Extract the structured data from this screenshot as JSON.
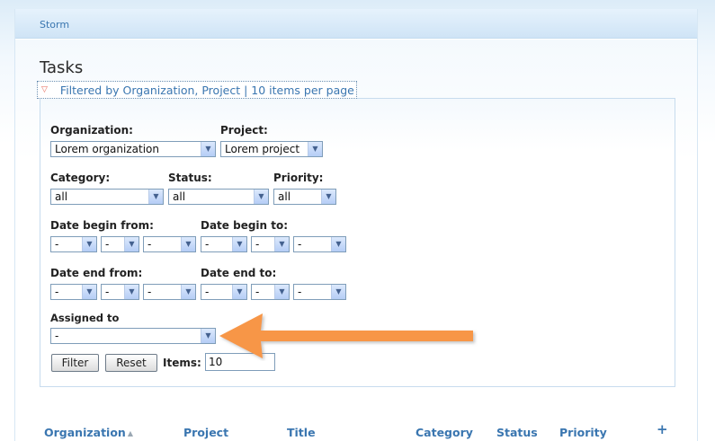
{
  "header": {
    "site_name": "Storm"
  },
  "page_title": "Tasks",
  "filter": {
    "legend": "Filtered by Organization, Project | 10 items per page",
    "organization": {
      "label": "Organization:",
      "value": "Lorem organization"
    },
    "project": {
      "label": "Project:",
      "value": "Lorem project"
    },
    "category": {
      "label": "Category:",
      "value": "all"
    },
    "status": {
      "label": "Status:",
      "value": "all"
    },
    "priority": {
      "label": "Priority:",
      "value": "all"
    },
    "date_begin_from": {
      "label": "Date begin from:",
      "values": [
        "-",
        "-",
        "-"
      ]
    },
    "date_begin_to": {
      "label": "Date begin to:",
      "values": [
        "-",
        "-",
        "-"
      ]
    },
    "date_end_from": {
      "label": "Date end from:",
      "values": [
        "-",
        "-",
        "-"
      ]
    },
    "date_end_to": {
      "label": "Date end to:",
      "values": [
        "-",
        "-",
        "-"
      ]
    },
    "assigned_to": {
      "label": "Assigned to",
      "value": "-"
    },
    "filter_button": "Filter",
    "reset_button": "Reset",
    "items_label": "Items:",
    "items_value": "10"
  },
  "callout": {
    "color": "#f79646"
  },
  "table": {
    "columns": [
      "Organization",
      "Project",
      "Title",
      "Category",
      "Status",
      "Priority"
    ],
    "add_icon": "plus-icon"
  }
}
